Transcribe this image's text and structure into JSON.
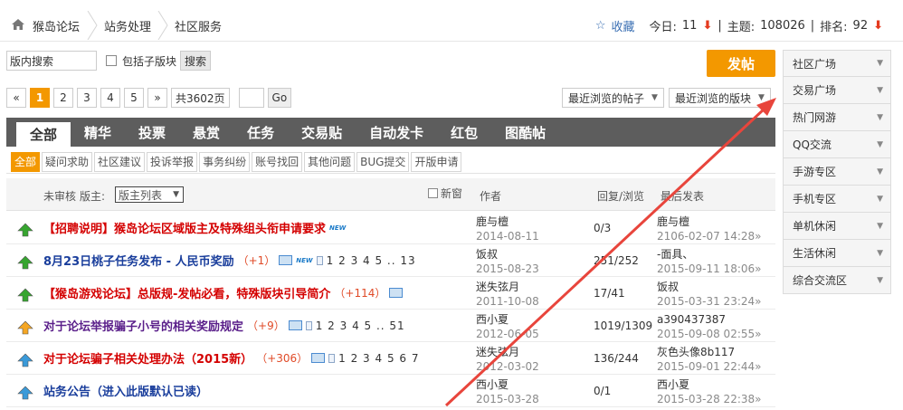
{
  "breadcrumb": {
    "items": [
      "猴岛论坛",
      "站务处理",
      "社区服务"
    ]
  },
  "stats": {
    "fav_label": "收藏",
    "today_label": "今日:",
    "today_value": "11",
    "topics_label": "主题:",
    "topics_value": "108026",
    "rank_label": "排名:",
    "rank_value": "92",
    "separator": "|"
  },
  "search": {
    "value": "版内搜索",
    "sub_label": "包括子版块",
    "button": "搜索"
  },
  "post_button": "发帖",
  "pager": {
    "prev": "«",
    "pages": [
      "1",
      "2",
      "3",
      "4",
      "5"
    ],
    "next": "»",
    "total": "共3602页",
    "go": "Go"
  },
  "dropdowns": {
    "recent_posts": "最近浏览的帖子",
    "recent_boards": "最近浏览的版块"
  },
  "tabs": [
    "全部",
    "精华",
    "投票",
    "悬赏",
    "任务",
    "交易贴",
    "自动发卡",
    "红包",
    "图酷帖"
  ],
  "subtabs": [
    "全部",
    "疑问求助",
    "社区建议",
    "投诉举报",
    "事务纠纷",
    "账号找回",
    "其他问题",
    "BUG提交",
    "开版申请"
  ],
  "table_header": {
    "unreviewed": "未审核",
    "moderator": "版主:",
    "mod_list": "版主列表",
    "new": "新窗",
    "author": "作者",
    "replies": "回复/浏览",
    "last": "最后发表"
  },
  "rows": [
    {
      "title": "【招聘说明】猴岛论坛区域版主及特殊组头衔申请要求",
      "color": "red",
      "heat": "",
      "pages": "",
      "author": "鹿与檀",
      "date": "2014-08-11",
      "replies": "0/3",
      "last_user": "鹿与檀",
      "last_date": "2106-02-07 14:28»",
      "new": true,
      "img": false
    },
    {
      "title": "8月23日桃子任务发布 - 人民币奖励",
      "color": "blue",
      "heat": "（+1）",
      "pages": "1 2 3 4 5 .. 13",
      "author": "饭叔",
      "date": "2015-08-23",
      "replies": "251/252",
      "last_user": "-面具、",
      "last_date": "2015-09-11 18:06»",
      "new": true,
      "img": true
    },
    {
      "title": "【猴岛游戏论坛】总版规-发帖必看，特殊版块引导简介",
      "color": "red",
      "heat": "（+114）",
      "pages": "",
      "author": "迷失弦月",
      "date": "2011-10-08",
      "replies": "17/41",
      "last_user": "饭叔",
      "last_date": "2015-03-31 23:24»",
      "new": false,
      "img": true
    },
    {
      "title": "对于论坛举报骗子小号的相关奖励规定",
      "color": "purple",
      "heat": "（+9）",
      "pages": "1 2 3 4 5 .. 51",
      "author": "西小夏",
      "date": "2012-06-05",
      "replies": "1019/1309",
      "last_user": "a390437387",
      "last_date": "2015-09-08 02:55»",
      "new": false,
      "img": true
    },
    {
      "title": "对于论坛骗子相关处理办法（2015新）",
      "color": "red",
      "heat": "（+306）",
      "pages": "1 2 3 4 5 6 7",
      "author": "迷失弦月",
      "date": "2012-03-02",
      "replies": "136/244",
      "last_user": "灰色头像8b117",
      "last_date": "2015-09-01 22:44»",
      "new": false,
      "img": true
    },
    {
      "title": "站务公告（进入此版默认已读）",
      "color": "blue",
      "heat": "",
      "pages": "",
      "author": "西小夏",
      "date": "2015-03-28",
      "replies": "0/1",
      "last_user": "西小夏",
      "last_date": "2015-03-28 22:38»",
      "new": false,
      "img": false
    }
  ],
  "sidebar": [
    "社区广场",
    "交易广场",
    "热门网游",
    "QQ交流",
    "手游专区",
    "手机专区",
    "单机休闲",
    "生活休闲",
    "综合交流区"
  ],
  "colors": {
    "accent": "#f39800",
    "tab_bg": "#5d5d5d",
    "annotation_arrow": "#e8453c"
  }
}
